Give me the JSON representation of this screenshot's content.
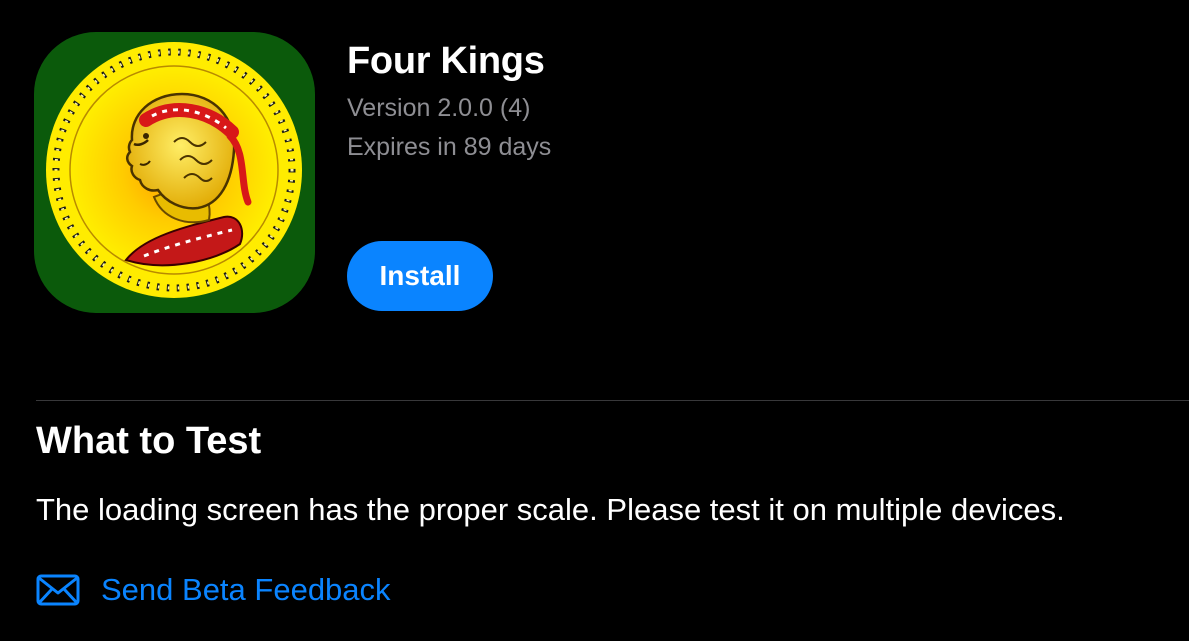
{
  "app": {
    "title": "Four Kings",
    "version": "Version 2.0.0 (4)",
    "expires": "Expires in 89 days",
    "install_label": "Install",
    "icon": "four-kings-coin-icon"
  },
  "what_to_test": {
    "heading": "What to Test",
    "body": "The loading screen has the proper scale. Please test it on multiple devices."
  },
  "feedback": {
    "label": "Send Beta Feedback",
    "icon": "envelope-icon"
  },
  "colors": {
    "background": "#000000",
    "accent": "#0a84ff",
    "secondary_text": "#8e8e93",
    "icon_green": "#0b5a0b",
    "coin_yellow": "#ffe600"
  }
}
